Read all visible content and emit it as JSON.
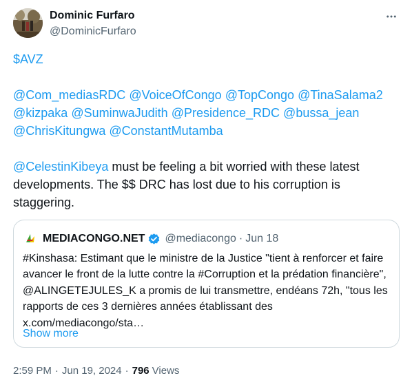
{
  "author": {
    "name": "Dominic Furfaro",
    "handle": "@DominicFurfaro"
  },
  "tweet": {
    "cashtag": "$AVZ",
    "mentions_block": [
      "@Com_mediasRDC",
      "@VoiceOfCongo",
      "@TopCongo",
      "@TinaSalama2",
      "@kizpaka",
      "@SuminwaJudith",
      "@Presidence_RDC",
      "@bussa_jean",
      "@ChrisKitungwa",
      "@ConstantMutamba"
    ],
    "lead_mention": "@CelestinKibeya",
    "body_text": " must be feeling a bit worried with these latest developments. The $$ DRC has lost due to his corruption is staggering."
  },
  "quote": {
    "name": "MEDIACONGO.NET",
    "handle": "@mediacongo",
    "separator": "·",
    "time": "Jun 18",
    "text": "#Kinshasa: Estimant que le ministre de la Justice \"tient à renforcer et faire avancer le front de la lutte contre la #Corruption et la prédation financière\", @ALINGETEJULES_K a promis de lui transmettre, endéans 72h, \"tous les rapports de ces 3 dernières années établissant des x.com/mediacongo/sta…",
    "show_more": "Show more"
  },
  "meta": {
    "time": "2:59 PM",
    "separator": "·",
    "date": "Jun 19, 2024",
    "views_count": "796",
    "views_label": "Views"
  },
  "colors": {
    "link": "#1d9bf0",
    "text": "#0f1419",
    "muted": "#536471",
    "border": "#cfd9de",
    "verified": "#1d9bf0"
  }
}
